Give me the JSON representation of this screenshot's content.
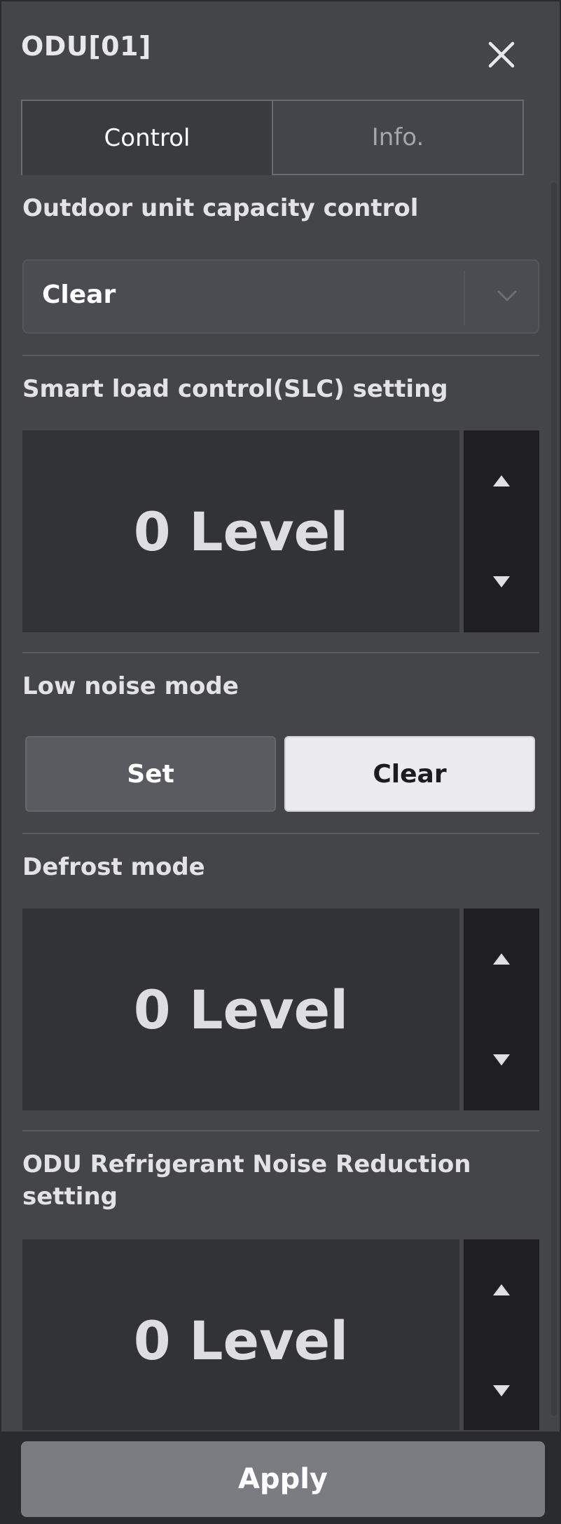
{
  "header": {
    "title": "ODU[01]",
    "close_icon": "close-icon"
  },
  "tabs": [
    {
      "label": "Control",
      "active": true
    },
    {
      "label": "Info.",
      "active": false
    }
  ],
  "sections": {
    "capacity": {
      "label": "Outdoor unit capacity control",
      "selected": "Clear"
    },
    "slc": {
      "label": "Smart load control(SLC) setting",
      "value": "0 Level"
    },
    "low_noise": {
      "label": "Low noise mode",
      "options": [
        "Set",
        "Clear"
      ],
      "selected": "Clear"
    },
    "defrost": {
      "label": "Defrost mode",
      "value": "0 Level"
    },
    "refrigerant_noise": {
      "label_line1": "ODU Refrigerant Noise Reduction",
      "label_line2": "setting",
      "value": "0 Level"
    }
  },
  "footer": {
    "apply_label": "Apply"
  },
  "colors": {
    "panel_bg": "#444549",
    "stepper_bg": "#323337",
    "stepper_controls_bg": "#1f1f22",
    "active_toggle": "#ebebf0",
    "apply_bg": "#7a7c81"
  }
}
